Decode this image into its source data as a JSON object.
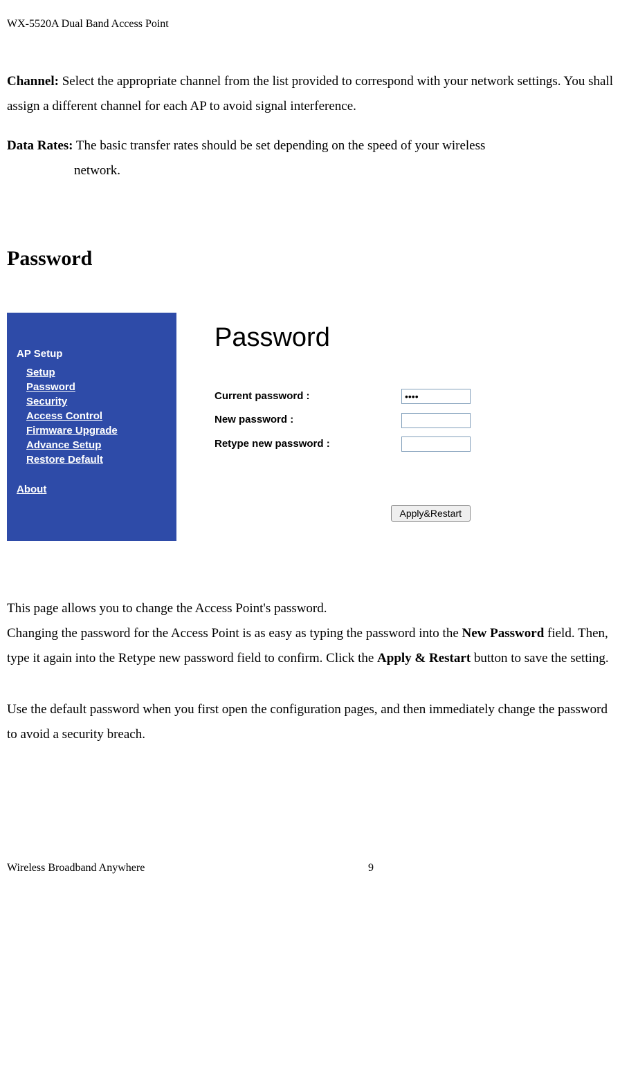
{
  "header": {
    "title": "WX-5520A Dual Band Access Point"
  },
  "section_channel": {
    "label": "Channel:",
    "text_part1": " Select the appropriate channel from the list provided to correspond with your network settings. You shall assign a different channel for each AP to avoid signal interference."
  },
  "section_data_rates": {
    "label": "Data Rates:",
    "text_line1": " The basic transfer rates should be set depending on the speed of your wireless",
    "text_line2": "network."
  },
  "password_heading": "Password",
  "sidebar": {
    "heading": "AP Setup",
    "items": [
      "Setup",
      "Password",
      "Security",
      "Access Control",
      "Firmware Upgrade",
      "Advance Setup",
      "Restore Default"
    ],
    "about": "About"
  },
  "content_panel": {
    "title": "Password",
    "current_password_label": "Current password :",
    "current_password_value": "••••",
    "new_password_label": "New password :",
    "retype_password_label": "Retype new password :",
    "apply_button": "Apply&Restart"
  },
  "body_text": {
    "p1_part1": "This page allows you to change the Access Point's password.",
    "p2_part1": "Changing the password for the Access Point is as easy as typing the password into the ",
    "p2_bold1": "New Password",
    "p2_part2": " field. Then, type it again into the Retype new password field to confirm. Click the ",
    "p2_bold2": "Apply & Restart",
    "p2_part3": " button to save the setting.",
    "p3": "Use the default password when you first open the configuration pages, and then immediately change the password to avoid a security breach."
  },
  "footer": {
    "text": "Wireless Broadband Anywhere",
    "page": "9"
  }
}
